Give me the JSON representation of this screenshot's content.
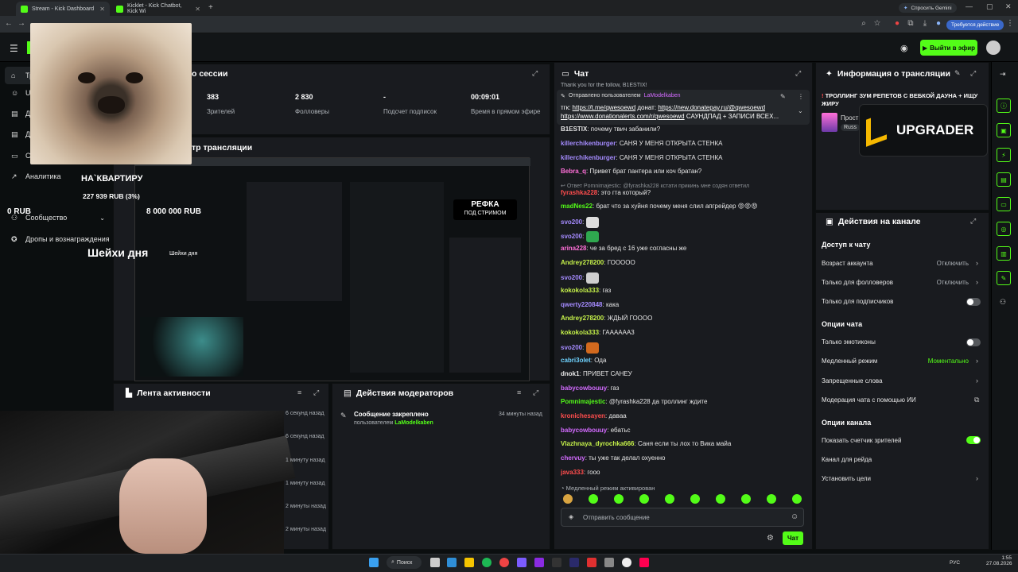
{
  "browser": {
    "tabs": [
      {
        "label": "Stream - Kick Dashboard",
        "active": true
      },
      {
        "label": "Kicklet - Kick Chatbot, Kick Wi",
        "active": false
      }
    ],
    "gemini_label": "Спросить Gemini",
    "action_required_label": "Требуется действие"
  },
  "header": {
    "go_live_label": "Выйти в эфир"
  },
  "sidebar": {
    "items": [
      {
        "label": "Тр",
        "icon": "home-icon"
      },
      {
        "label": "U",
        "icon": "user-icon"
      },
      {
        "label": "Д",
        "icon": "doc-icon"
      },
      {
        "label": "Д",
        "icon": "doc-icon"
      },
      {
        "label": "С",
        "icon": "chat-icon"
      },
      {
        "label": "Аналитика",
        "icon": "chart-icon"
      },
      {
        "label": "Сообщество",
        "icon": "people-icon"
      },
      {
        "label": "Дропы и вознаграждения",
        "icon": "gift-icon"
      }
    ]
  },
  "overlay": {
    "apartment_label": "НА`КВАРТИРУ",
    "goal_amount": "227 939 RUB (3%)",
    "zero_rub": "0 RUB",
    "goal_total": "8 000 000 RUB",
    "shake_label": "Шейхи дня",
    "shake_small": "Шейхи дня",
    "refka_title": "РЕФКА",
    "refka_sub": "ПОД СТРИМОМ",
    "upgrader_label": "UPGRADER"
  },
  "session": {
    "title": "о сессии",
    "stats": [
      {
        "value": "383",
        "label": "Зрителей"
      },
      {
        "value": "2 830",
        "label": "Фолловеры"
      },
      {
        "value": "-",
        "label": "Подсчет подписок"
      },
      {
        "value": "00:09:01",
        "label": "Время в прямом эфире"
      }
    ],
    "preview_title": "тр трансляции"
  },
  "activity": {
    "title": "Лента активности",
    "times": [
      "6 секунд назад",
      "6 секунд назад",
      "1 минуту назад",
      "1 минуту назад",
      "2 минуты назад",
      "2 минуты назад",
      "3 минуты назад"
    ]
  },
  "moderation": {
    "title": "Действия модераторов",
    "item_title": "Сообщение закреплено",
    "item_by": "пользователем",
    "item_user": "LaModelkaben",
    "item_time": "34 минуты назад"
  },
  "chat": {
    "title": "Чат",
    "pinned_by": "Отправлено пользователем",
    "pinned_user": "LaModelkaben",
    "pinned_line1_label": "тгк:",
    "pinned_line1_link": "https://t.me/qwesoewd",
    "pinned_line1_mid": "донат:",
    "pinned_line1_link2": "https://new.donatepay.ru/@qwesoewd",
    "pinned_line2_link": "https://www.donationalerts.com/r/qwesoewd",
    "pinned_line2_rest": "САУНДПАД + ЗАПИСИ ВСЕХ...",
    "top_partial": "Thank you for the follow, B1ESTIX!",
    "reply_note": "Ответ Pomnimajestic: @fyrashka228 кстати прикинь мне содян ответил",
    "slow_mode_note": "Медленный режим активирован",
    "input_placeholder": "Отправить сообщение",
    "send_label": "Чат",
    "messages": [
      {
        "user": "B1ESTIX",
        "color": "#e6e6e6",
        "text": "почему твич забанили?"
      },
      {
        "user": "killerchikenburger",
        "color": "#a58bff",
        "text": "САНЯ У МЕНЯ ОТКРЫТА СТЕНКА"
      },
      {
        "user": "killerchikenburger",
        "color": "#a58bff",
        "text": "САНЯ У МЕНЯ ОТКРЫТА СТЕНКА"
      },
      {
        "user": "Bebra_q",
        "color": "#ff6fd8",
        "text": "Привет брат пантера или коч братан?"
      },
      {
        "user": "fyrashka228",
        "color": "#ff4d4d",
        "text": "это гта который?"
      },
      {
        "user": "madNes22",
        "color": "#53fc18",
        "text": "брат что за хуйня почему меня слил апгрейдер 😡😡😡"
      },
      {
        "user": "svo200",
        "color": "#a58bff",
        "text": ""
      },
      {
        "user": "svo200",
        "color": "#a58bff",
        "text": ""
      },
      {
        "user": "arina228",
        "color": "#ff6fd8",
        "text": "че за бред с 16 уже согласны же"
      },
      {
        "user": "Andrey278200",
        "color": "#c6f24a",
        "text": "ГООООО"
      },
      {
        "user": "svo200",
        "color": "#a58bff",
        "text": ""
      },
      {
        "user": "kokokola333",
        "color": "#c6f24a",
        "text": "газ"
      },
      {
        "user": "qwerty220848",
        "color": "#a58bff",
        "text": "кака"
      },
      {
        "user": "Andrey278200",
        "color": "#c6f24a",
        "text": "ЖДЫЙ ГОООО"
      },
      {
        "user": "kokokola333",
        "color": "#c6f24a",
        "text": "ГАААААА3"
      },
      {
        "user": "svo200",
        "color": "#a58bff",
        "text": ""
      },
      {
        "user": "cabri3olet",
        "color": "#6fd3ff",
        "text": "Ода"
      },
      {
        "user": "dnok1",
        "color": "#e6e6e6",
        "text": "ПРИВЕТ САНЕУ"
      },
      {
        "user": "babycowbouuy",
        "color": "#d36bff",
        "text": "газ"
      },
      {
        "user": "Pomnimajestic",
        "color": "#53fc18",
        "text": "@fyrashka228 да троллинг ждите"
      },
      {
        "user": "kronichesayen",
        "color": "#ff4d4d",
        "text": "дaвaa"
      },
      {
        "user": "babycowbouuy",
        "color": "#d36bff",
        "text": "ебатьс"
      },
      {
        "user": "Vlazhnaya_dyrochka666",
        "color": "#c6f24a",
        "text": "Саня если ты лох то Вика майа"
      },
      {
        "user": "chervuy",
        "color": "#d36bff",
        "text": "ты уже так делал охуенно"
      },
      {
        "user": "java333",
        "color": "#ff4d4d",
        "text": "гооо"
      }
    ]
  },
  "info": {
    "title": "Информация о трансляции",
    "stream_title": "ТРОЛЛИНГ ЗУМ РЕПЕТОВ С ВЕБКОЙ ДАУНА + ИЩУ ЖИРУ",
    "category_partial": "Прост",
    "lang_partial": "Russ"
  },
  "channel": {
    "title": "Действия на канале",
    "section_chat_access": "Доступ к чату",
    "account_age_label": "Возраст аккаунта",
    "account_age_value": "Отключить",
    "followers_only_label": "Только для фолловеров",
    "followers_only_value": "Отключить",
    "subs_only_label": "Только для подписчиков",
    "section_chat_options": "Опции чата",
    "emotes_only_label": "Только эмотиконы",
    "slow_mode_label": "Медленный режим",
    "slow_mode_value": "Моментально",
    "banned_words_label": "Запрещенные слова",
    "ai_mod_label": "Модерация чата с помощью ИИ",
    "section_channel_options": "Опции канала",
    "viewer_count_label": "Показать счетчик зрителей",
    "raid_label": "Канал для рейда",
    "goals_label": "Установить цели"
  },
  "taskbar": {
    "search_label": "Поиск",
    "lang": "РУС",
    "time": "1:55",
    "date": "27.08.2026"
  },
  "colors": {
    "accent": "#53fc18",
    "panel": "#191b1f",
    "bg": "#0b0e0f"
  }
}
